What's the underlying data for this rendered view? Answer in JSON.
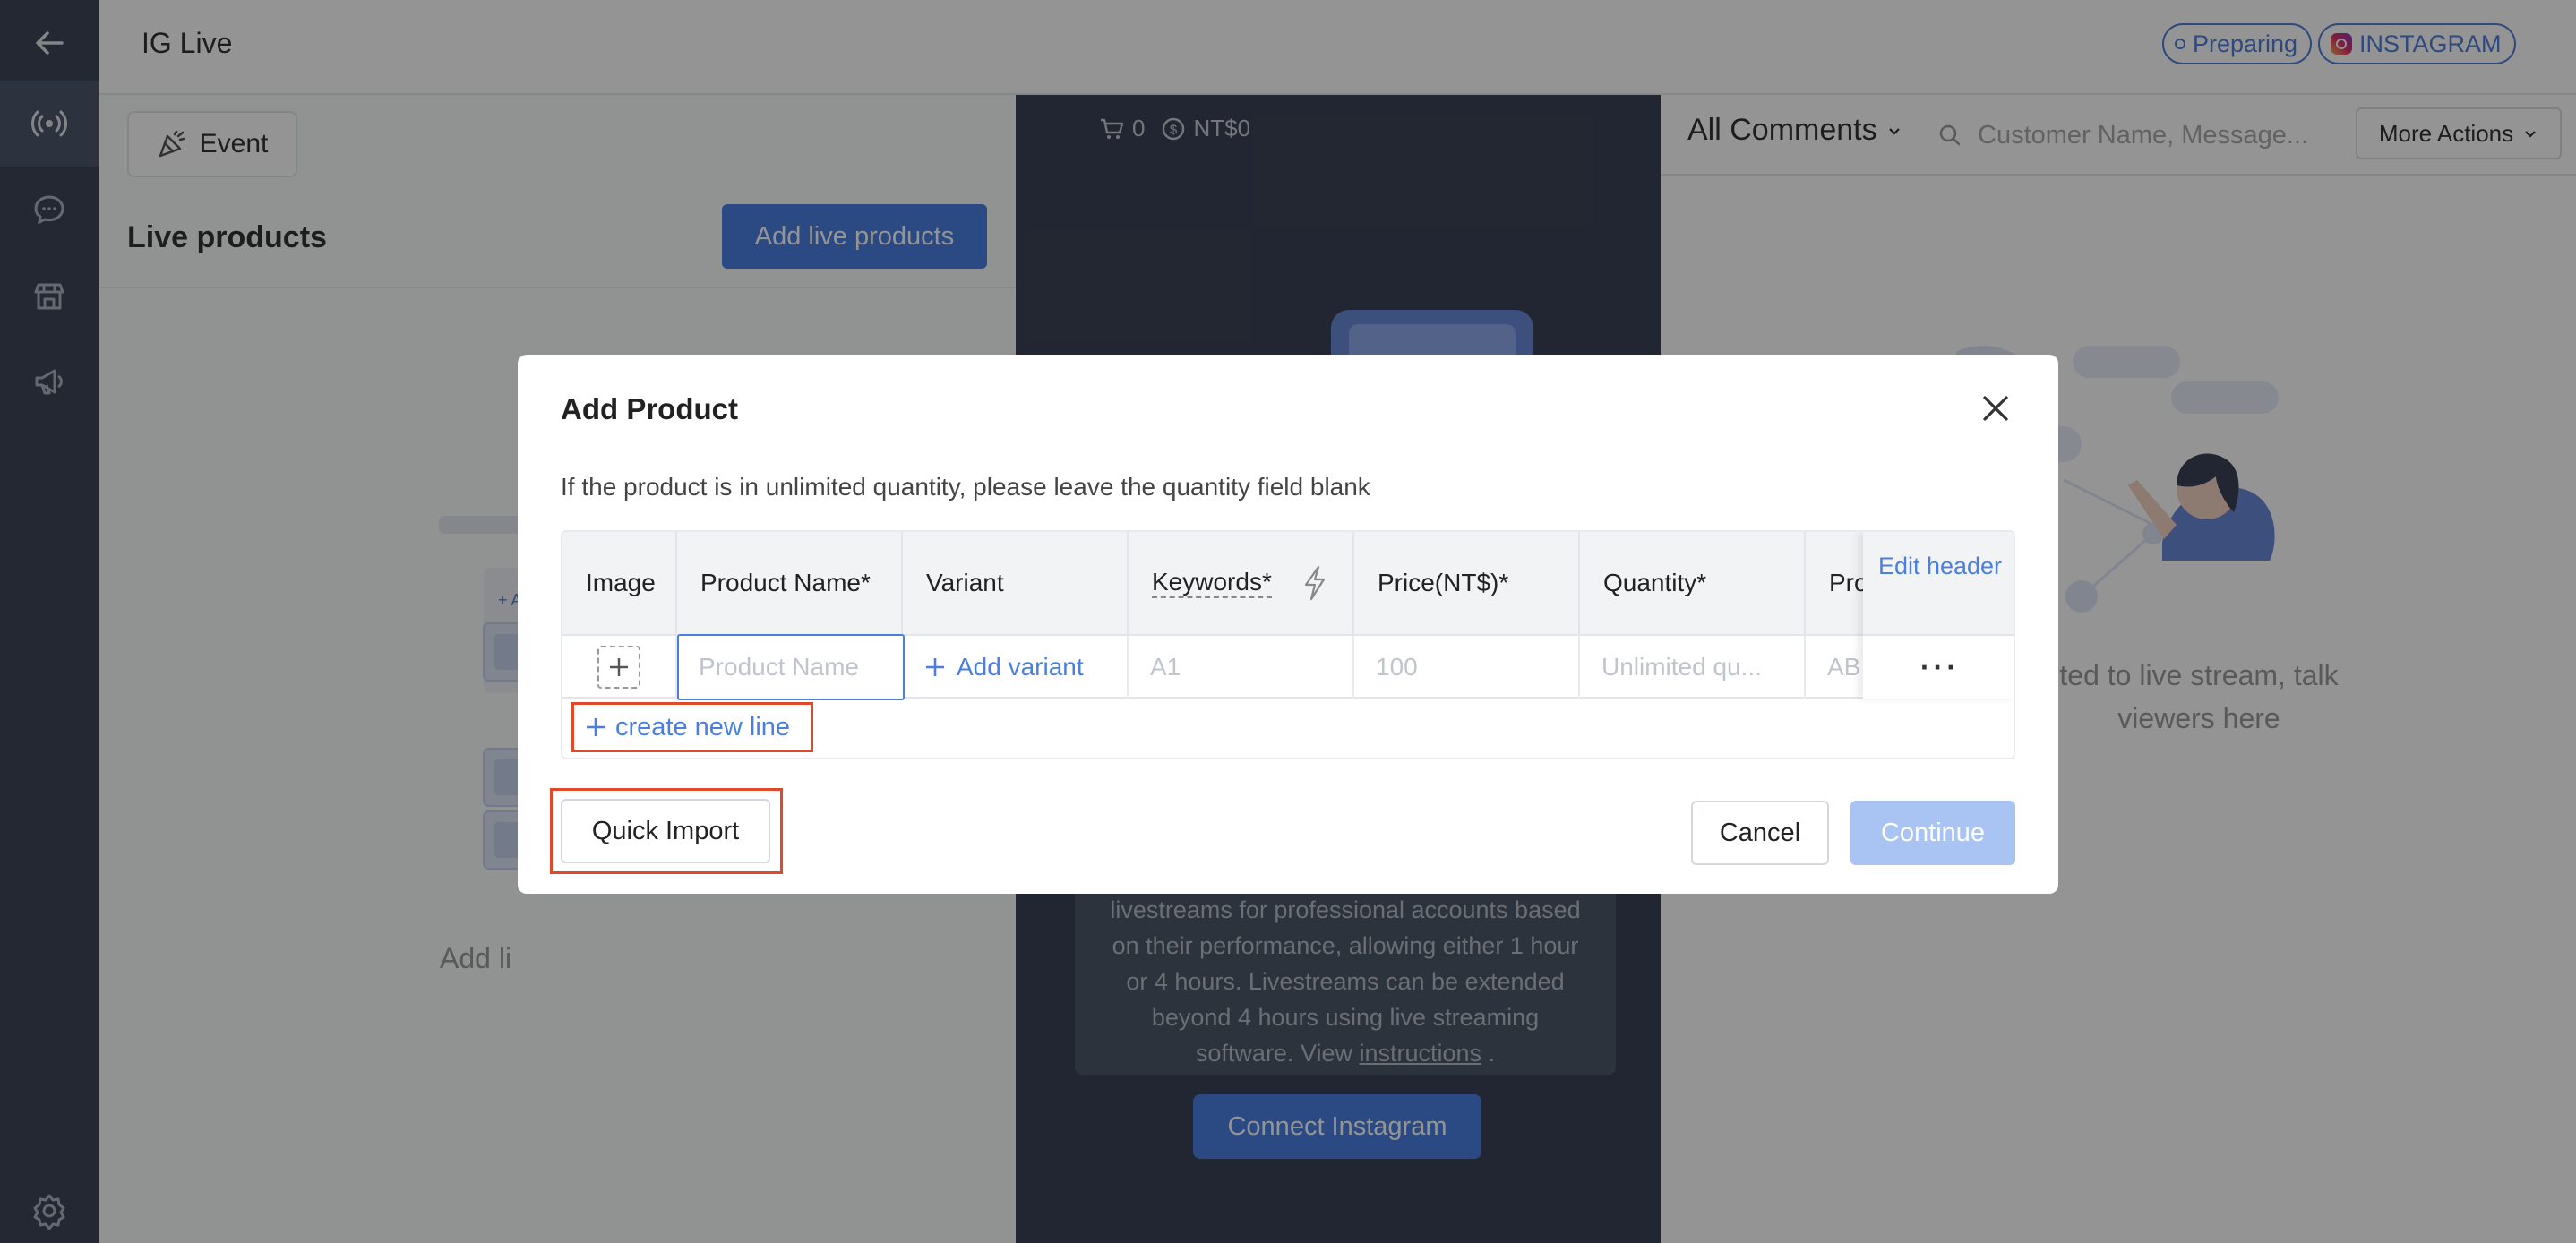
{
  "header": {
    "title": "IG Live",
    "status_badge": "Preparing",
    "platform_badge": "INSTAGRAM"
  },
  "left_panel": {
    "event_button": "Event",
    "section_title": "Live products",
    "add_button": "Add live products",
    "illustration_add_label": "+ Add",
    "empty_text": "Add li"
  },
  "center_panel": {
    "cart_count": "0",
    "revenue": "NT$0",
    "notice_lines": [
      "livestreams for professional accounts based",
      "on their performance, allowing either 1 hour",
      "or 4 hours. Livestreams can be extended",
      "beyond 4 hours using live streaming",
      "software. View"
    ],
    "notice_link": "instructions",
    "notice_end": ".",
    "connect_button": "Connect Instagram"
  },
  "right_panel": {
    "filter_label": "All Comments",
    "search_placeholder": "Customer Name, Message...",
    "more_actions": "More Actions",
    "empty_line1": "ted to live stream, talk",
    "empty_line2": "viewers here"
  },
  "modal": {
    "title": "Add Product",
    "description": "If the product is in unlimited quantity, please leave the quantity field blank",
    "columns": {
      "image": "Image",
      "product_name": "Product Name*",
      "variant": "Variant",
      "keywords": "Keywords*",
      "price": "Price(NT$)*",
      "quantity": "Quantity*",
      "product_code": "Pro",
      "edit_header": "Edit header"
    },
    "row": {
      "product_name_placeholder": "Product Name",
      "add_variant": "Add variant",
      "keywords_placeholder": "A1",
      "price_placeholder": "100",
      "quantity_placeholder": "Unlimited qu...",
      "code_placeholder": "AB"
    },
    "create_new_line": "create new line",
    "quick_import": "Quick Import",
    "cancel": "Cancel",
    "continue": "Continue"
  },
  "colors": {
    "accent": "#4a7fe0",
    "sidebar": "#3e4657",
    "highlight": "#e04a2b",
    "disabled_button": "#a9c3f3"
  }
}
